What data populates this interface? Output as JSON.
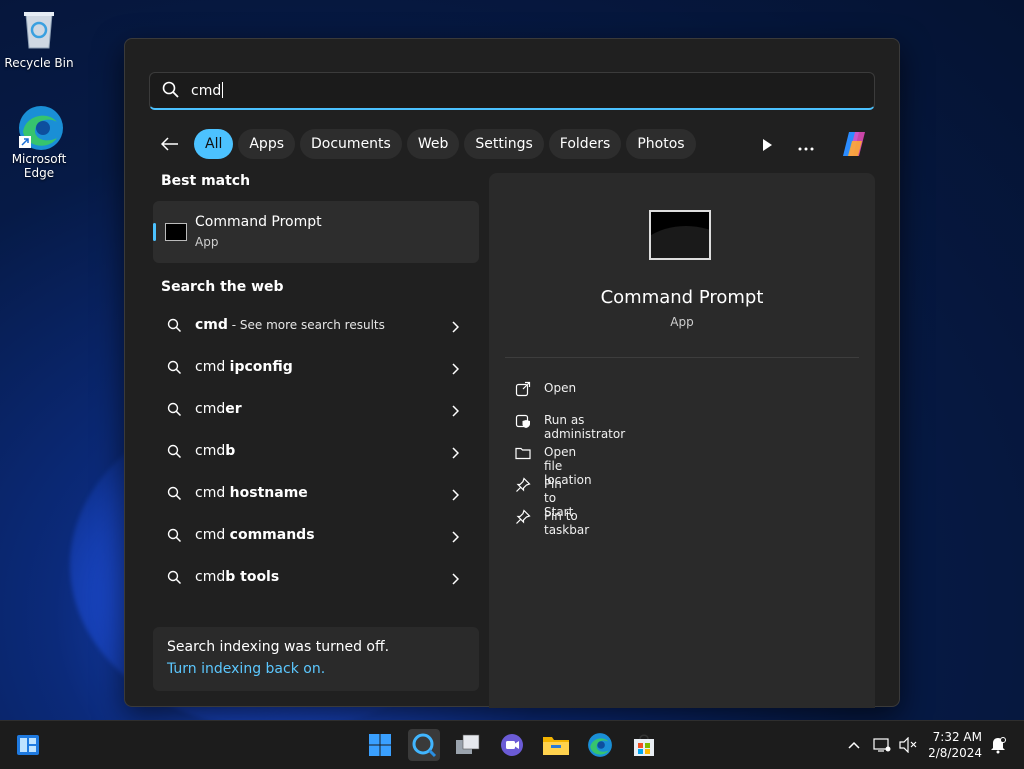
{
  "desktop": {
    "icons": [
      {
        "label": "Recycle Bin"
      },
      {
        "label_line1": "Microsoft",
        "label_line2": "Edge"
      }
    ]
  },
  "search": {
    "value": "cmd"
  },
  "filters": [
    "All",
    "Apps",
    "Documents",
    "Web",
    "Settings",
    "Folders",
    "Photos"
  ],
  "best_match": {
    "section_label": "Best match",
    "title": "Command Prompt",
    "subtitle": "App"
  },
  "web": {
    "section_label": "Search the web",
    "items": [
      {
        "prefix": "cmd",
        "bold": "",
        "extra": " - See more search results"
      },
      {
        "prefix": "cmd ",
        "bold": "ipconfig",
        "extra": ""
      },
      {
        "prefix": "cmd",
        "bold": "er",
        "extra": ""
      },
      {
        "prefix": "cmd",
        "bold": "b",
        "extra": ""
      },
      {
        "prefix": "cmd ",
        "bold": "hostname",
        "extra": ""
      },
      {
        "prefix": "cmd ",
        "bold": "commands",
        "extra": ""
      },
      {
        "prefix": "cmd",
        "bold": "b tools",
        "extra": ""
      }
    ]
  },
  "notice": {
    "text": "Search indexing was turned off.",
    "link": "Turn indexing back on."
  },
  "preview": {
    "title": "Command Prompt",
    "subtitle": "App",
    "actions": [
      {
        "label": "Open",
        "icon": "open-external-icon"
      },
      {
        "label": "Run as administrator",
        "icon": "shield-admin-icon"
      },
      {
        "label": "Open file location",
        "icon": "folder-icon"
      },
      {
        "label": "Pin to Start",
        "icon": "pin-icon"
      },
      {
        "label": "Pin to taskbar",
        "icon": "pin-icon"
      }
    ]
  },
  "taskbar": {
    "time": "7:32 AM",
    "date": "2/8/2024"
  },
  "colors": {
    "accent": "#4cc2ff",
    "panel": "#202020",
    "link": "#5cc8ff"
  }
}
